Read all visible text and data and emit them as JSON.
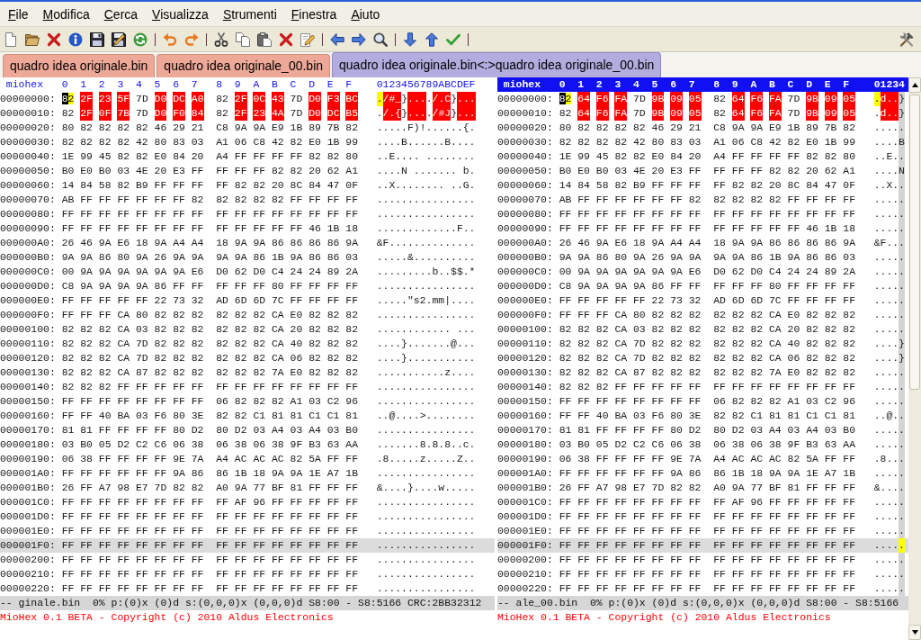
{
  "menu": [
    "File",
    "Modifica",
    "Cerca",
    "Visualizza",
    "Strumenti",
    "Finestra",
    "Aiuto"
  ],
  "tabs": [
    {
      "label": "quadro idea originale.bin",
      "selected": false
    },
    {
      "label": "quadro idea originale_00.bin",
      "selected": false
    },
    {
      "label": "quadro idea originale.bin<:>quadro idea originale_00.bin",
      "selected": true
    }
  ],
  "panes": [
    {
      "active": false,
      "hover_column": false,
      "header": {
        "title": "miohex",
        "columns": [
          "0",
          "1",
          "2",
          "3",
          "4",
          "5",
          "6",
          "7",
          "8",
          "9",
          "A",
          "B",
          "C",
          "D",
          "E",
          "F"
        ],
        "ascii": "0123456789ABCDEF"
      },
      "rows": [
        {
          "kind": "compare",
          "offset": "00000000:",
          "highlighted": false,
          "cells": [
            {
              "hex": "82",
              "char": ".",
              "diff": false,
              "cursor": true
            },
            {
              "hex": "2F",
              "char": "/",
              "diff": true,
              "cursor": false
            },
            {
              "hex": "23",
              "char": "#",
              "diff": true,
              "cursor": false
            },
            {
              "hex": "5F",
              "char": "_",
              "diff": true,
              "cursor": false
            },
            {
              "hex": "7D",
              "char": "}",
              "diff": false,
              "cursor": false
            },
            {
              "hex": "D0",
              "char": ".",
              "diff": true,
              "cursor": false
            },
            {
              "hex": "DC",
              "char": ".",
              "diff": true,
              "cursor": false
            },
            {
              "hex": "A0",
              "char": ".",
              "diff": true,
              "cursor": false
            },
            {
              "hex": "82",
              "char": ".",
              "diff": false,
              "cursor": false
            },
            {
              "hex": "2F",
              "char": "/",
              "diff": true,
              "cursor": false
            },
            {
              "hex": "0C",
              "char": ".",
              "diff": true,
              "cursor": false
            },
            {
              "hex": "43",
              "char": "C",
              "diff": true,
              "cursor": false
            },
            {
              "hex": "7D",
              "char": "}",
              "diff": false,
              "cursor": false
            },
            {
              "hex": "D0",
              "char": ".",
              "diff": true,
              "cursor": false
            },
            {
              "hex": "F3",
              "char": ".",
              "diff": true,
              "cursor": false
            },
            {
              "hex": "BC",
              "char": ".",
              "diff": true,
              "cursor": false
            }
          ]
        },
        {
          "kind": "compare",
          "offset": "00000010:",
          "highlighted": false,
          "cells": [
            {
              "hex": "82",
              "char": ".",
              "diff": false,
              "cursor": false
            },
            {
              "hex": "2F",
              "char": "/",
              "diff": true,
              "cursor": false
            },
            {
              "hex": "0F",
              "char": ".",
              "diff": true,
              "cursor": false
            },
            {
              "hex": "7B",
              "char": "{",
              "diff": true,
              "cursor": false
            },
            {
              "hex": "7D",
              "char": "}",
              "diff": false,
              "cursor": false
            },
            {
              "hex": "D0",
              "char": ".",
              "diff": true,
              "cursor": false
            },
            {
              "hex": "F0",
              "char": ".",
              "diff": true,
              "cursor": false
            },
            {
              "hex": "84",
              "char": ".",
              "diff": true,
              "cursor": false
            },
            {
              "hex": "82",
              "char": ".",
              "diff": false,
              "cursor": false
            },
            {
              "hex": "2F",
              "char": "/",
              "diff": true,
              "cursor": false
            },
            {
              "hex": "23",
              "char": "#",
              "diff": true,
              "cursor": false
            },
            {
              "hex": "4A",
              "char": "J",
              "diff": true,
              "cursor": false
            },
            {
              "hex": "7D",
              "char": "}",
              "diff": false,
              "cursor": false
            },
            {
              "hex": "D0",
              "char": ".",
              "diff": true,
              "cursor": false
            },
            {
              "hex": "DC",
              "char": ".",
              "diff": true,
              "cursor": false
            },
            {
              "hex": "B5",
              "char": ".",
              "diff": true,
              "cursor": false
            }
          ]
        },
        {
          "kind": "plain",
          "offset": "00000020:",
          "hex_left": "80 82 82 82 82 46 29 21",
          "hex_right": "C8 9A 9A E9 1B 89 7B 82",
          "ascii": ".....F)!......{.",
          "highlighted": false
        },
        {
          "kind": "plain",
          "offset": "00000030:",
          "hex_left": "82 82 82 82 42 80 83 03",
          "hex_right": "A1 06 C8 42 82 E0 1B 99",
          "ascii": "....B......B....",
          "highlighted": false
        },
        {
          "kind": "plain",
          "offset": "00000040:",
          "hex_left": "1E 99 45 82 82 E0 84 20",
          "hex_right": "A4 FF FF FF FF 82 82 80",
          "ascii": "..E.... ........",
          "highlighted": false
        },
        {
          "kind": "plain",
          "offset": "00000050:",
          "hex_left": "B0 E0 B0 03 4E 20 E3 FF",
          "hex_right": "FF FF FF 82 82 20 62 A1",
          "ascii": "....N ....... b.",
          "highlighted": false
        },
        {
          "kind": "plain",
          "offset": "00000060:",
          "hex_left": "14 84 58 82 B9 FF FF FF",
          "hex_right": "FF 82 82 20 8C 84 47 0F",
          "ascii": "..X........ ..G.",
          "highlighted": false
        },
        {
          "kind": "plain",
          "offset": "00000070:",
          "hex_left": "AB FF FF FF FF FF FF 82",
          "hex_right": "82 82 82 82 FF FF FF FF",
          "ascii": "................",
          "highlighted": false
        },
        {
          "kind": "plain",
          "offset": "00000080:",
          "hex_left": "FF FF FF FF FF FF FF FF",
          "hex_right": "FF FF FF FF FF FF FF FF",
          "ascii": "................",
          "highlighted": false
        },
        {
          "kind": "plain",
          "offset": "00000090:",
          "hex_left": "FF FF FF FF FF FF FF FF",
          "hex_right": "FF FF FF FF FF 46 1B 18",
          "ascii": ".............F..",
          "highlighted": false
        },
        {
          "kind": "plain",
          "offset": "000000A0:",
          "hex_left": "26 46 9A E6 18 9A A4 A4",
          "hex_right": "18 9A 9A 86 86 86 86 9A",
          "ascii": "&F..............",
          "highlighted": false
        },
        {
          "kind": "plain",
          "offset": "000000B0:",
          "hex_left": "9A 9A 86 80 9A 26 9A 9A",
          "hex_right": "9A 9A 86 1B 9A 86 86 03",
          "ascii": ".....&..........",
          "highlighted": false
        },
        {
          "kind": "plain",
          "offset": "000000C0:",
          "hex_left": "00 9A 9A 9A 9A 9A 9A E6",
          "hex_right": "D0 62 D0 C4 24 24 89 2A",
          "ascii": ".........b..$$.*",
          "highlighted": false
        },
        {
          "kind": "plain",
          "offset": "000000D0:",
          "hex_left": "C8 9A 9A 9A 9A 86 FF FF",
          "hex_right": "FF FF FF 80 FF FF FF FF",
          "ascii": "................",
          "highlighted": false
        },
        {
          "kind": "plain",
          "offset": "000000E0:",
          "hex_left": "FF FF FF FF FF 22 73 32",
          "hex_right": "AD 6D 6D 7C FF FF FF FF",
          "ascii": ".....\"s2.mm|....",
          "highlighted": false
        },
        {
          "kind": "plain",
          "offset": "000000F0:",
          "hex_left": "FF FF FF CA 80 82 82 82",
          "hex_right": "82 82 82 CA E0 82 82 82",
          "ascii": "................",
          "highlighted": false
        },
        {
          "kind": "plain",
          "offset": "00000100:",
          "hex_left": "82 82 82 CA 03 82 82 82",
          "hex_right": "82 82 82 CA 20 82 82 82",
          "ascii": "............ ...",
          "highlighted": false
        },
        {
          "kind": "plain",
          "offset": "00000110:",
          "hex_left": "82 82 82 CA 7D 82 82 82",
          "hex_right": "82 82 82 CA 40 82 82 82",
          "ascii": "....}.......@...",
          "highlighted": false
        },
        {
          "kind": "plain",
          "offset": "00000120:",
          "hex_left": "82 82 82 CA 7D 82 82 82",
          "hex_right": "82 82 82 CA 06 82 82 82",
          "ascii": "....}...........",
          "highlighted": false
        },
        {
          "kind": "plain",
          "offset": "00000130:",
          "hex_left": "82 82 82 CA 87 82 82 82",
          "hex_right": "82 82 82 7A E0 82 82 82",
          "ascii": "...........z....",
          "highlighted": false
        },
        {
          "kind": "plain",
          "offset": "00000140:",
          "hex_left": "82 82 82 FF FF FF FF FF",
          "hex_right": "FF FF FF FF FF FF FF FF",
          "ascii": "................",
          "highlighted": false
        },
        {
          "kind": "plain",
          "offset": "00000150:",
          "hex_left": "FF FF FF FF FF FF FF FF",
          "hex_right": "06 82 82 82 A1 03 C2 96",
          "ascii": "................",
          "highlighted": false
        },
        {
          "kind": "plain",
          "offset": "00000160:",
          "hex_left": "FF FF 40 BA 03 F6 80 3E",
          "hex_right": "82 82 C1 81 81 C1 C1 81",
          "ascii": "..@....>........",
          "highlighted": false
        },
        {
          "kind": "plain",
          "offset": "00000170:",
          "hex_left": "81 81 FF FF FF FF 80 D2",
          "hex_right": "80 D2 03 A4 03 A4 03 B0",
          "ascii": "................",
          "highlighted": false
        },
        {
          "kind": "plain",
          "offset": "00000180:",
          "hex_left": "03 B0 05 D2 C2 C6 06 38",
          "hex_right": "06 38 06 38 9F B3 63 AA",
          "ascii": ".......8.8.8..c.",
          "highlighted": false
        },
        {
          "kind": "plain",
          "offset": "00000190:",
          "hex_left": "06 38 FF FF FF FF 9E 7A",
          "hex_right": "A4 AC AC AC 82 5A FF FF",
          "ascii": ".8.....z.....Z..",
          "highlighted": false
        },
        {
          "kind": "plain",
          "offset": "000001A0:",
          "hex_left": "FF FF FF FF FF FF 9A 86",
          "hex_right": "86 1B 18 9A 9A 1E A7 1B",
          "ascii": "................",
          "highlighted": false
        },
        {
          "kind": "plain",
          "offset": "000001B0:",
          "hex_left": "26 FF A7 98 E7 7D 82 82",
          "hex_right": "A0 9A 77 BF 81 FF FF FF",
          "ascii": "&....}....w.....",
          "highlighted": false
        },
        {
          "kind": "plain",
          "offset": "000001C0:",
          "hex_left": "FF FF FF FF FF FF FF FF",
          "hex_right": "FF AF 96 FF FF FF FF FF",
          "ascii": "................",
          "highlighted": false
        },
        {
          "kind": "plain",
          "offset": "000001D0:",
          "hex_left": "FF FF FF FF FF FF FF FF",
          "hex_right": "FF FF FF FF FF FF FF FF",
          "ascii": "................",
          "highlighted": false
        },
        {
          "kind": "plain",
          "offset": "000001E0:",
          "hex_left": "FF FF FF FF FF FF FF FF",
          "hex_right": "FF FF FF FF FF FF FF FF",
          "ascii": "................",
          "highlighted": false
        },
        {
          "kind": "plain",
          "offset": "000001F0:",
          "hex_left": "FF FF FF FF FF FF FF FF",
          "hex_right": "FF FF FF FF FF FF FF FF",
          "ascii": "................",
          "highlighted": true
        },
        {
          "kind": "plain",
          "offset": "00000200:",
          "hex_left": "FF FF FF FF FF FF FF FF",
          "hex_right": "FF FF FF FF FF FF FF FF",
          "ascii": "................",
          "highlighted": false
        },
        {
          "kind": "plain",
          "offset": "00000210:",
          "hex_left": "FF FF FF FF FF FF FF FF",
          "hex_right": "FF FF FF FF FF FF FF FF",
          "ascii": "................",
          "highlighted": false
        },
        {
          "kind": "plain",
          "offset": "00000220:",
          "hex_left": "FF FF FF FF FF FF FF FF",
          "hex_right": "FF FF FF FF FF FF FF FF",
          "ascii": "................",
          "highlighted": false
        }
      ],
      "status": "-- ginale.bin  0% p:(0)x (0)d s:(0,0,0)x (0,0,0)d S8:00 - S8:5166 CRC:2BB32312",
      "footer": "MioHex 0.1 BETA - Copyright (c) 2010 Aldus Electronics"
    },
    {
      "active": true,
      "hover_column": true,
      "header": {
        "title": "miohex",
        "columns": [
          "0",
          "1",
          "2",
          "3",
          "4",
          "5",
          "6",
          "7",
          "8",
          "9",
          "A",
          "B",
          "C",
          "D",
          "E",
          "F"
        ],
        "ascii": "01234"
      },
      "rows": [
        {
          "kind": "compare",
          "offset": "00000000:",
          "highlighted": false,
          "cells": [
            {
              "hex": "82",
              "char": ".",
              "diff": false,
              "cursor": true
            },
            {
              "hex": "64",
              "char": "d",
              "diff": true,
              "cursor": false
            },
            {
              "hex": "F6",
              "char": ".",
              "diff": true,
              "cursor": false
            },
            {
              "hex": "FA",
              "char": ".",
              "diff": true,
              "cursor": false
            },
            {
              "hex": "7D",
              "char": "}",
              "diff": false,
              "cursor": false
            },
            {
              "hex": "9B",
              "diff": true,
              "cursor": false
            },
            {
              "hex": "09",
              "diff": true,
              "cursor": false
            },
            {
              "hex": "05",
              "diff": true,
              "cursor": false
            },
            {
              "hex": "82",
              "diff": false,
              "cursor": false
            },
            {
              "hex": "64",
              "diff": true,
              "cursor": false
            },
            {
              "hex": "F6",
              "diff": true,
              "cursor": false
            },
            {
              "hex": "FA",
              "diff": true,
              "cursor": false
            },
            {
              "hex": "7D",
              "diff": false,
              "cursor": false
            },
            {
              "hex": "9B",
              "diff": true,
              "cursor": false
            },
            {
              "hex": "09",
              "diff": true,
              "cursor": false
            },
            {
              "hex": "05",
              "diff": true,
              "cursor": false
            }
          ]
        },
        {
          "kind": "compare",
          "offset": "00000010:",
          "highlighted": false,
          "cells": [
            {
              "hex": "82",
              "char": ".",
              "diff": false,
              "cursor": false
            },
            {
              "hex": "64",
              "char": "d",
              "diff": true,
              "cursor": false
            },
            {
              "hex": "F6",
              "char": ".",
              "diff": true,
              "cursor": false
            },
            {
              "hex": "FA",
              "char": ".",
              "diff": true,
              "cursor": false
            },
            {
              "hex": "7D",
              "char": "}",
              "diff": false,
              "cursor": false
            },
            {
              "hex": "9B",
              "diff": true,
              "cursor": false
            },
            {
              "hex": "09",
              "diff": true,
              "cursor": false
            },
            {
              "hex": "05",
              "diff": true,
              "cursor": false
            },
            {
              "hex": "82",
              "diff": false,
              "cursor": false
            },
            {
              "hex": "64",
              "diff": true,
              "cursor": false
            },
            {
              "hex": "F6",
              "diff": true,
              "cursor": false
            },
            {
              "hex": "FA",
              "diff": true,
              "cursor": false
            },
            {
              "hex": "7D",
              "diff": false,
              "cursor": false
            },
            {
              "hex": "9B",
              "diff": true,
              "cursor": false
            },
            {
              "hex": "09",
              "diff": true,
              "cursor": false
            },
            {
              "hex": "05",
              "diff": true,
              "cursor": false
            }
          ]
        },
        {
          "kind": "plain",
          "offset": "00000020:",
          "hex_left": "80 82 82 82 82 46 29 21",
          "hex_right": "C8 9A 9A E9 1B 89 7B 82",
          "ascii": ".....",
          "highlighted": false
        },
        {
          "kind": "plain",
          "offset": "00000030:",
          "hex_left": "82 82 82 82 42 80 83 03",
          "hex_right": "A1 06 C8 42 82 E0 1B 99",
          "ascii": "....B",
          "highlighted": false
        },
        {
          "kind": "plain",
          "offset": "00000040:",
          "hex_left": "1E 99 45 82 82 E0 84 20",
          "hex_right": "A4 FF FF FF FF 82 82 80",
          "ascii": "..E..",
          "highlighted": false
        },
        {
          "kind": "plain",
          "offset": "00000050:",
          "hex_left": "B0 E0 B0 03 4E 20 E3 FF",
          "hex_right": "FF FF FF 82 82 20 62 A1",
          "ascii": "....N",
          "highlighted": false
        },
        {
          "kind": "plain",
          "offset": "00000060:",
          "hex_left": "14 84 58 82 B9 FF FF FF",
          "hex_right": "FF 82 82 20 8C 84 47 0F",
          "ascii": "..X..",
          "highlighted": false
        },
        {
          "kind": "plain",
          "offset": "00000070:",
          "hex_left": "AB FF FF FF FF FF FF 82",
          "hex_right": "82 82 82 82 FF FF FF FF",
          "ascii": ".....",
          "highlighted": false
        },
        {
          "kind": "plain",
          "offset": "00000080:",
          "hex_left": "FF FF FF FF FF FF FF FF",
          "hex_right": "FF FF FF FF FF FF FF FF",
          "ascii": ".....",
          "highlighted": false
        },
        {
          "kind": "plain",
          "offset": "00000090:",
          "hex_left": "FF FF FF FF FF FF FF FF",
          "hex_right": "FF FF FF FF FF 46 1B 18",
          "ascii": ".....",
          "highlighted": false
        },
        {
          "kind": "plain",
          "offset": "000000A0:",
          "hex_left": "26 46 9A E6 18 9A A4 A4",
          "hex_right": "18 9A 9A 86 86 86 86 9A",
          "ascii": "&F...",
          "highlighted": false
        },
        {
          "kind": "plain",
          "offset": "000000B0:",
          "hex_left": "9A 9A 86 80 9A 26 9A 9A",
          "hex_right": "9A 9A 86 1B 9A 86 86 03",
          "ascii": ".....",
          "highlighted": false
        },
        {
          "kind": "plain",
          "offset": "000000C0:",
          "hex_left": "00 9A 9A 9A 9A 9A 9A E6",
          "hex_right": "D0 62 D0 C4 24 24 89 2A",
          "ascii": ".....",
          "highlighted": false
        },
        {
          "kind": "plain",
          "offset": "000000D0:",
          "hex_left": "C8 9A 9A 9A 9A 86 FF FF",
          "hex_right": "FF FF FF 80 FF FF FF FF",
          "ascii": ".....",
          "highlighted": false
        },
        {
          "kind": "plain",
          "offset": "000000E0:",
          "hex_left": "FF FF FF FF FF 22 73 32",
          "hex_right": "AD 6D 6D 7C FF FF FF FF",
          "ascii": ".....",
          "highlighted": false
        },
        {
          "kind": "plain",
          "offset": "000000F0:",
          "hex_left": "FF FF FF CA 80 82 82 82",
          "hex_right": "82 82 82 CA E0 82 82 82",
          "ascii": ".....",
          "highlighted": false
        },
        {
          "kind": "plain",
          "offset": "00000100:",
          "hex_left": "82 82 82 CA 03 82 82 82",
          "hex_right": "82 82 82 CA 20 82 82 82",
          "ascii": ".....",
          "highlighted": false
        },
        {
          "kind": "plain",
          "offset": "00000110:",
          "hex_left": "82 82 82 CA 7D 82 82 82",
          "hex_right": "82 82 82 CA 40 82 82 82",
          "ascii": "....}",
          "highlighted": false
        },
        {
          "kind": "plain",
          "offset": "00000120:",
          "hex_left": "82 82 82 CA 7D 82 82 82",
          "hex_right": "82 82 82 CA 06 82 82 82",
          "ascii": "....}",
          "highlighted": false
        },
        {
          "kind": "plain",
          "offset": "00000130:",
          "hex_left": "82 82 82 CA 87 82 82 82",
          "hex_right": "82 82 82 7A E0 82 82 82",
          "ascii": ".....",
          "highlighted": false
        },
        {
          "kind": "plain",
          "offset": "00000140:",
          "hex_left": "82 82 82 FF FF FF FF FF",
          "hex_right": "FF FF FF FF FF FF FF FF",
          "ascii": ".....",
          "highlighted": false
        },
        {
          "kind": "plain",
          "offset": "00000150:",
          "hex_left": "FF FF FF FF FF FF FF FF",
          "hex_right": "06 82 82 82 A1 03 C2 96",
          "ascii": ".....",
          "highlighted": false
        },
        {
          "kind": "plain",
          "offset": "00000160:",
          "hex_left": "FF FF 40 BA 03 F6 80 3E",
          "hex_right": "82 82 C1 81 81 C1 C1 81",
          "ascii": "..@..",
          "highlighted": false
        },
        {
          "kind": "plain",
          "offset": "00000170:",
          "hex_left": "81 81 FF FF FF FF 80 D2",
          "hex_right": "80 D2 03 A4 03 A4 03 B0",
          "ascii": ".....",
          "highlighted": false
        },
        {
          "kind": "plain",
          "offset": "00000180:",
          "hex_left": "03 B0 05 D2 C2 C6 06 38",
          "hex_right": "06 38 06 38 9F B3 63 AA",
          "ascii": ".....",
          "highlighted": false
        },
        {
          "kind": "plain",
          "offset": "00000190:",
          "hex_left": "06 38 FF FF FF FF 9E 7A",
          "hex_right": "A4 AC AC AC 82 5A FF FF",
          "ascii": ".8...",
          "highlighted": false
        },
        {
          "kind": "plain",
          "offset": "000001A0:",
          "hex_left": "FF FF FF FF FF FF 9A 86",
          "hex_right": "86 1B 18 9A 9A 1E A7 1B",
          "ascii": ".....",
          "highlighted": false
        },
        {
          "kind": "plain",
          "offset": "000001B0:",
          "hex_left": "26 FF A7 98 E7 7D 82 82",
          "hex_right": "A0 9A 77 BF 81 FF FF FF",
          "ascii": "&....",
          "highlighted": false
        },
        {
          "kind": "plain",
          "offset": "000001C0:",
          "hex_left": "FF FF FF FF FF FF FF FF",
          "hex_right": "FF AF 96 FF FF FF FF FF",
          "ascii": ".....",
          "highlighted": false
        },
        {
          "kind": "plain",
          "offset": "000001D0:",
          "hex_left": "FF FF FF FF FF FF FF FF",
          "hex_right": "FF FF FF FF FF FF FF FF",
          "ascii": ".....",
          "highlighted": false
        },
        {
          "kind": "plain",
          "offset": "000001E0:",
          "hex_left": "FF FF FF FF FF FF FF FF",
          "hex_right": "FF FF FF FF FF FF FF FF",
          "ascii": ".....",
          "highlighted": false
        },
        {
          "kind": "plain",
          "offset": "000001F0:",
          "hex_left": "FF FF FF FF FF FF FF FF",
          "hex_right": "FF FF FF FF FF FF FF FF",
          "ascii": ".....",
          "highlighted": true
        },
        {
          "kind": "plain",
          "offset": "00000200:",
          "hex_left": "FF FF FF FF FF FF FF FF",
          "hex_right": "FF FF FF FF FF FF FF FF",
          "ascii": ".....",
          "highlighted": false
        },
        {
          "kind": "plain",
          "offset": "00000210:",
          "hex_left": "FF FF FF FF FF FF FF FF",
          "hex_right": "FF FF FF FF FF FF FF FF",
          "ascii": ".....",
          "highlighted": false
        },
        {
          "kind": "plain",
          "offset": "00000220:",
          "hex_left": "FF FF FF FF FF FF FF FF",
          "hex_right": "FF FF FF FF FF FF FF FF",
          "ascii": ".....",
          "highlighted": false
        }
      ],
      "status": "-- ale_00.bin  0% p:(0)x (0)d s:(0,0,0)x (0,0,0)d S8:00 - S8:5166",
      "footer": "MioHex 0.1 BETA - Copyright (c) 2010 Aldus Electronics"
    }
  ]
}
